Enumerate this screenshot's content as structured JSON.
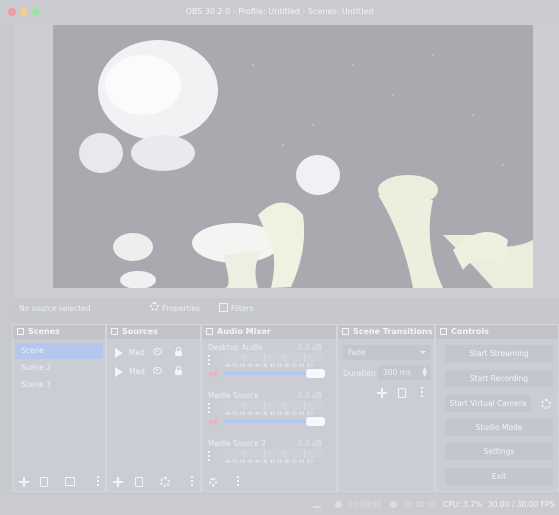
{
  "window": {
    "title": "OBS 30.2.0 - Profile: Untitled - Scenes: Untitled"
  },
  "source_bar": {
    "status": "No source selected",
    "properties_label": "Properties",
    "filters_label": "Filters"
  },
  "scenes_dock": {
    "title": "Scenes",
    "items": [
      {
        "label": "Scene"
      },
      {
        "label": "Scene 2"
      },
      {
        "label": "Scene 3"
      }
    ],
    "selected_index": 0
  },
  "sources_dock": {
    "title": "Sources",
    "items": [
      {
        "label": "Med"
      },
      {
        "label": "Med"
      }
    ]
  },
  "audio_mixer": {
    "title": "Audio Mixer",
    "meter_ticks": "-60 -55 -50 -45 -40 -35 -30 -25 -20 -15 -10 -5 0",
    "channels": [
      {
        "name": "Desktop Audio",
        "db": "0.0 dB",
        "volume": 1.0
      },
      {
        "name": "Media Source",
        "db": "0.0 dB",
        "volume": 1.0
      },
      {
        "name": "Media Source 2",
        "db": "0.0 dB",
        "volume": 1.0
      }
    ]
  },
  "scene_transitions": {
    "title": "Scene Transitions",
    "transition": "Fade",
    "duration_label": "Duration",
    "duration_value": "300 ms"
  },
  "controls": {
    "title": "Controls",
    "start_streaming": "Start Streaming",
    "start_recording": "Start Recording",
    "start_virtual_camera": "Start Virtual Camera",
    "studio_mode": "Studio Mode",
    "settings": "Settings",
    "exit": "Exit"
  },
  "status_bar": {
    "stream_time": "00:00:00",
    "record_time": "00:00:00",
    "cpu": "CPU: 3.7%",
    "fps": "30.00 / 30.00 FPS"
  },
  "colors": {
    "accent": "#b4c7ef",
    "mute": "#efb0b8",
    "close_button": "#ef9ca0",
    "minimize_button": "#f2d08f",
    "maximize_button": "#99e6a4"
  }
}
